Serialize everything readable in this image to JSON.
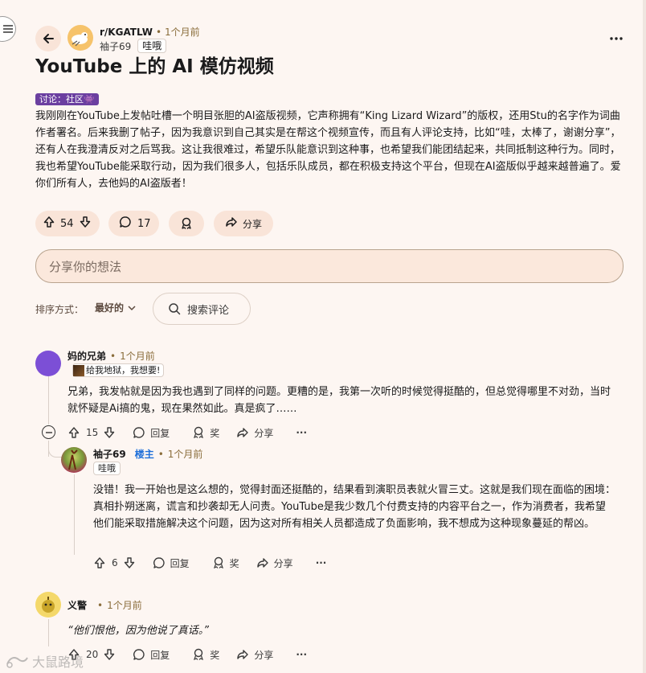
{
  "post": {
    "subreddit": "r/KGATLW",
    "time": "1个月前",
    "author": "袖子69",
    "author_flair": "哇哦",
    "title": "YouTube 上的 AI 模仿视频",
    "flair": "讨论：社区👾",
    "body": "我刚刚在YouTube上发帖吐槽一个明目张胆的AI盗版视频，它声称拥有“King Lizard Wizard”的版权，还用Stu的名字作为词曲作者署名。后来我删了帖子，因为我意识到自己其实是在帮这个视频宣传，而且有人评论支持，比如“哇，太棒了，谢谢分享”，还有人在我澄清反对之后骂我。这让我很难过，希望乐队能意识到这种事，也希望我们能团结起来，共同抵制这种行为。同时，我也希望YouTube能采取行动，因为我们很多人，包括乐队成员，都在积极支持这个平台，但现在AI盗版似乎越来越普遍了。爱你们所有人，去他妈的AI盗版者！",
    "votes": "54",
    "comments": "17",
    "share": "分享"
  },
  "comment_box": {
    "placeholder": "分享你的想法"
  },
  "sort": {
    "label": "排序方式：",
    "value": "最好的"
  },
  "search": {
    "label": "搜索评论"
  },
  "actions": {
    "reply": "回复",
    "award": "奖",
    "share": "分享",
    "more": "···"
  },
  "comments": [
    {
      "author": "妈的兄弟",
      "time": "1个月前",
      "flair": "给我地狱，我想要!",
      "body": "兄弟，我发帖就是因为我也遇到了同样的问题。更糟的是，我第一次听的时候觉得挺酷的，但总觉得哪里不对劲，当时就怀疑是Ai搞的鬼，现在果然如此。真是疯了……",
      "votes": "15"
    },
    {
      "author": "袖子69",
      "op_tag": "楼主",
      "time": "1个月前",
      "flair": "哇哦",
      "body": "没错！我一开始也是这么想的，觉得封面还挺酷的，结果看到演职员表就火冒三丈。这就是我们现在面临的困境：真相扑朔迷离，谎言和抄袭却无人问责。YouTube是我少数几个付费支持的内容平台之一，作为消费者，我希望他们能采取措施解决这个问题，因为这对所有相关人员都造成了负面影响，我不想成为这种现象蔓延的帮凶。",
      "votes": "6"
    },
    {
      "author": "义警",
      "time": "1个月前",
      "body": "“他们恨他，因为他说了真话。”",
      "votes": "20"
    }
  ],
  "watermark": "大鼠路境",
  "colors": {
    "background": "#fdf6f2",
    "pill": "#f9e4d8",
    "flair_bg": "#6b3fa0",
    "op": "#1e6fd9",
    "avatar_purple": "#7c4fd6"
  }
}
